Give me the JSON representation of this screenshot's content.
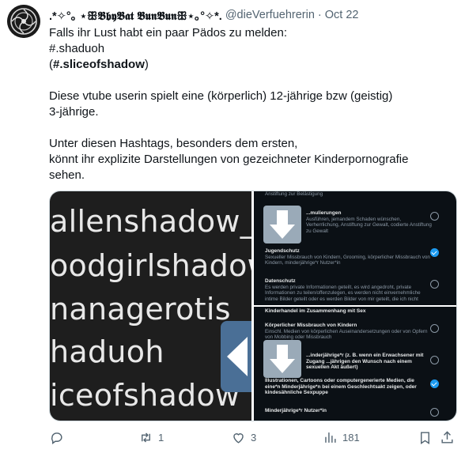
{
  "tweet": {
    "display_name": ".*✧°｡ ⋆ꕥ𝕭𝖇𝖞𝕭𝖆𝖙 𝕭𝖚𝖓𝕭𝖚𝖓ꕥ⋆｡°✧*.",
    "handle": "@dieVerfuehrerin",
    "separator": "·",
    "date": "Oct 22",
    "lines": {
      "l1": "Falls ihr Lust habt ein paar Pädos zu melden:",
      "l2": "#.shaduoh",
      "l3_open": "(",
      "l3_bold": "#.sliceofshadow",
      "l3_close": ")",
      "l4": "Diese vtube userin spielt eine (körperlich) 12-jährige bzw (geistig)",
      "l5": "3-jährige.",
      "l6": "Unter diesen Hashtags, besonders dem ersten,",
      "l7": "könnt ihr explizite Darstellungen von gezeichneter Kinderpornografie",
      "l8": "sehen."
    }
  },
  "media": {
    "left_lines": [
      "allenshadow_yt",
      "oodgirlshadow",
      "nanagerotis",
      "haduoh",
      "iceofshadow"
    ],
    "top_panel": {
      "o0_desc": "Anstiftung zur Belästigung",
      "o1_title": "...mulierungen",
      "o1_desc": "Ausführen, jemandem Schaden wünschen, Verherrlichung, Anstiftung zur Gewalt, codierte Anstiftung zu Gewalt",
      "o2_title": "Jugendschutz",
      "o2_desc": "Sexueller Missbrauch von Kindern, Grooming, körperlicher Missbrauch von Kindern, minderjährige*r Nutzer*in",
      "o3_title": "Datenschutz",
      "o3_desc": "Es werden private Informationen geteilt, es wird angedroht, private Informationen zu teilen/offenzulegen, es werden nicht einvernehmliche intime Bilder geteilt oder es werden Bilder von mir geteilt, die ich nicht"
    },
    "bottom_panel": {
      "o0_title": "Kinderhandel im Zusammenhang mit Sex",
      "o1_title": "Körperlicher Missbrauch von Kindern",
      "o1_desc": "Einschl. Medien von körperlichen Auseinandersetzungen oder von Opfern von Mobbing oder Missbrauch",
      "o2_title": "...inderjährige*r (z. B. wenn ein Erwachsener mit Zugang ...jährigen den Wunsch nach einem sexuellen Akt äußert)",
      "o3_title": "Illustrationen, Cartoons oder computergenerierte Medien, die eine*n Minderjährige*n bei einem Geschlechtsakt zeigen, oder kindesähnliche Sexpuppe",
      "o4_title": "Minderjährige*r Nutzer*in"
    }
  },
  "actions": {
    "reply_count": "",
    "retweet_count": "1",
    "like_count": "3",
    "views_count": "181"
  }
}
